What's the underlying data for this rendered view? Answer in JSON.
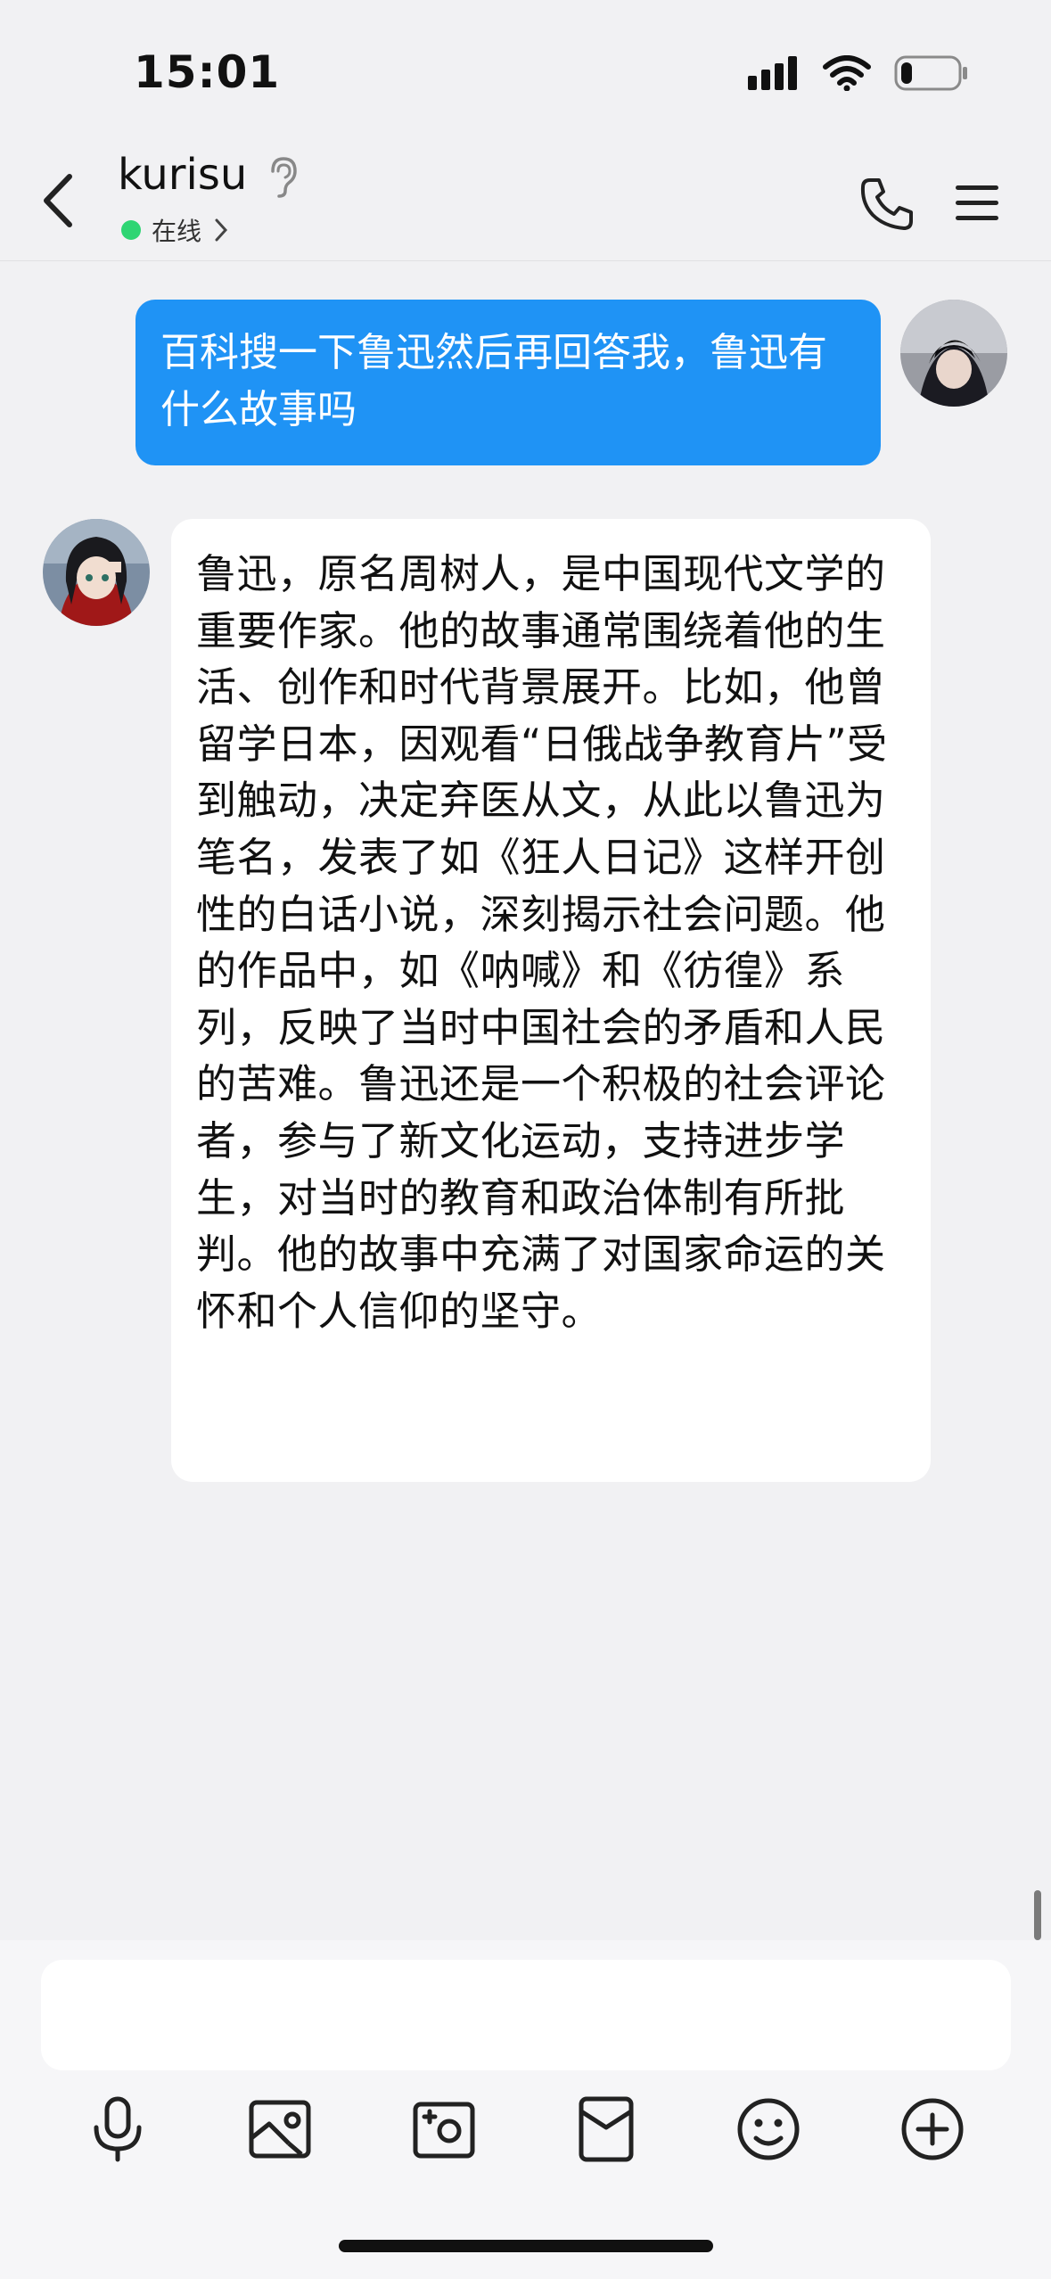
{
  "status_bar": {
    "time": "15:01",
    "battery_level": 0.2
  },
  "header": {
    "contact_name": "kurisu",
    "presence": "在线",
    "accent_online": "#2ed573"
  },
  "messages": [
    {
      "side": "outgoing",
      "text": "百科搜一下鲁迅然后再回答我，鲁迅有什么故事吗"
    },
    {
      "side": "incoming",
      "text": "鲁迅，原名周树人，是中国现代文学的重要作家。他的故事通常围绕着他的生活、创作和时代背景展开。比如，他曾留学日本，因观看“日俄战争教育片”受到触动，决定弃医从文，从此以鲁迅为笔名，发表了如《狂人日记》这样开创性的白话小说，深刻揭示社会问题。他的作品中，如《呐喊》和《彷徨》系列，反映了当时中国社会的矛盾和人民的苦难。鲁迅还是一个积极的社会评论者，参与了新文化运动，支持进步学生，对当时的教育和政治体制有所批判。他的故事中充满了对国家命运的关怀和个人信仰的坚守。"
    }
  ],
  "composer": {
    "value": ""
  },
  "toolbar": {
    "icons": [
      "microphone-icon",
      "image-icon",
      "camera-icon",
      "red-packet-icon",
      "emoji-icon",
      "plus-icon"
    ]
  },
  "colors": {
    "outgoing_bubble": "#1f93f5",
    "background": "#f1f1f3"
  }
}
